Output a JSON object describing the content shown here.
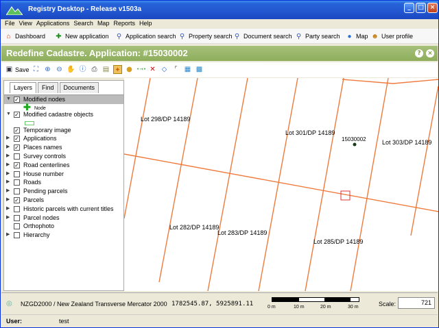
{
  "window": {
    "title": "Registry Desktop - Release v1503a"
  },
  "menu": [
    "File",
    "View",
    "Applications",
    "Search",
    "Map",
    "Reports",
    "Help"
  ],
  "nav": [
    {
      "label": "Dashboard",
      "icon": "home-icon"
    },
    {
      "label": "New application",
      "icon": "plus-icon"
    },
    {
      "label": "Application search",
      "icon": "search-icon"
    },
    {
      "label": "Property search",
      "icon": "search-icon"
    },
    {
      "label": "Document search",
      "icon": "search-icon"
    },
    {
      "label": "Party search",
      "icon": "search-icon"
    },
    {
      "label": "Map",
      "icon": "globe-icon"
    },
    {
      "label": "User profile",
      "icon": "user-icon"
    }
  ],
  "header": {
    "title": "Redefine Cadastre. Application: #15030002"
  },
  "map_toolbar": {
    "save_label": "Save"
  },
  "tabs": [
    "Layers",
    "Find",
    "Documents"
  ],
  "layers": [
    {
      "label": "Modified nodes",
      "checked": true,
      "expand": "down",
      "selected": true
    },
    {
      "legend": "node",
      "label": "Node"
    },
    {
      "label": "Modified cadastre objects",
      "checked": true,
      "expand": "down"
    },
    {
      "legend": "rect"
    },
    {
      "label": "Temporary image",
      "checked": true,
      "expand": ""
    },
    {
      "label": "Applications",
      "checked": true,
      "expand": "right"
    },
    {
      "label": "Places names",
      "checked": true,
      "expand": "right"
    },
    {
      "label": "Survey controls",
      "checked": false,
      "expand": "right"
    },
    {
      "label": "Road centerlines",
      "checked": true,
      "expand": "right"
    },
    {
      "label": "House number",
      "checked": false,
      "expand": "right"
    },
    {
      "label": "Roads",
      "checked": false,
      "expand": "right"
    },
    {
      "label": "Pending parcels",
      "checked": false,
      "expand": "right"
    },
    {
      "label": "Parcels",
      "checked": true,
      "expand": "right"
    },
    {
      "label": "Historic parcels with current titles",
      "checked": false,
      "expand": "right"
    },
    {
      "label": "Parcel nodes",
      "checked": false,
      "expand": "right"
    },
    {
      "label": "Orthophoto",
      "checked": false,
      "expand": ""
    },
    {
      "label": "Hierarchy",
      "checked": false,
      "expand": "right"
    }
  ],
  "map": {
    "labels": {
      "lot298": "Lot 298/DP 14189",
      "lot301": "Lot 301/DP 14189",
      "app": "15030002",
      "lot303": "Lot 303/DP 14189",
      "lot282": "Lot 282/DP 14189",
      "lot283": "Lot 283/DP 14189",
      "lot285": "Lot 285/DP 14189"
    },
    "line_color": "#f07a3c"
  },
  "status": {
    "crs": "NZGD2000 / New Zealand Transverse Mercator 2000",
    "coords": "1782545.87, 5925891.11",
    "scale_ticks": [
      "0 m",
      "10 m",
      "20 m",
      "30 m"
    ],
    "scale_label": "Scale:",
    "scale_value": "721"
  },
  "user": {
    "label": "User:",
    "value": "test"
  }
}
